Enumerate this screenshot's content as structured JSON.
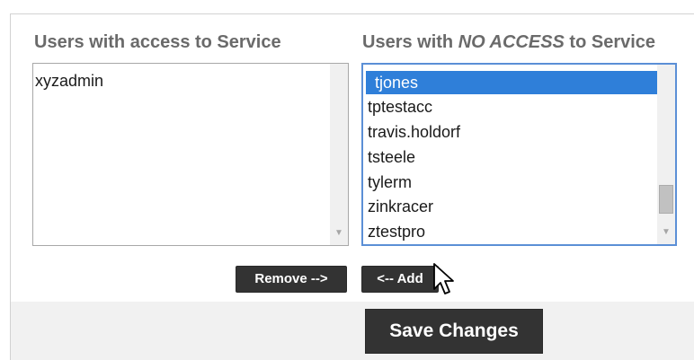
{
  "panel": {
    "access_heading": "Users with access to Service",
    "no_access_heading_prefix": "Users with ",
    "no_access_heading_emphasis": "NO ACCESS",
    "no_access_heading_suffix": " to Service"
  },
  "access_list": {
    "items": [
      "xyzadmin"
    ]
  },
  "no_access_list": {
    "items": [
      "tjones",
      "tptestacc",
      "travis.holdorf",
      "tsteele",
      "tylerm",
      "zinkracer",
      "ztestpro"
    ],
    "selected": "tjones"
  },
  "buttons": {
    "remove_label": "Remove -->",
    "add_label": "<-- Add",
    "save_label": "Save Changes"
  },
  "icons": {
    "scroll_down": "chevron-down-icon",
    "cursor": "mouse-pointer-icon"
  },
  "colors": {
    "selection": "#2f7fd9",
    "button": "#333333",
    "focus_border": "#5b8fd6"
  }
}
